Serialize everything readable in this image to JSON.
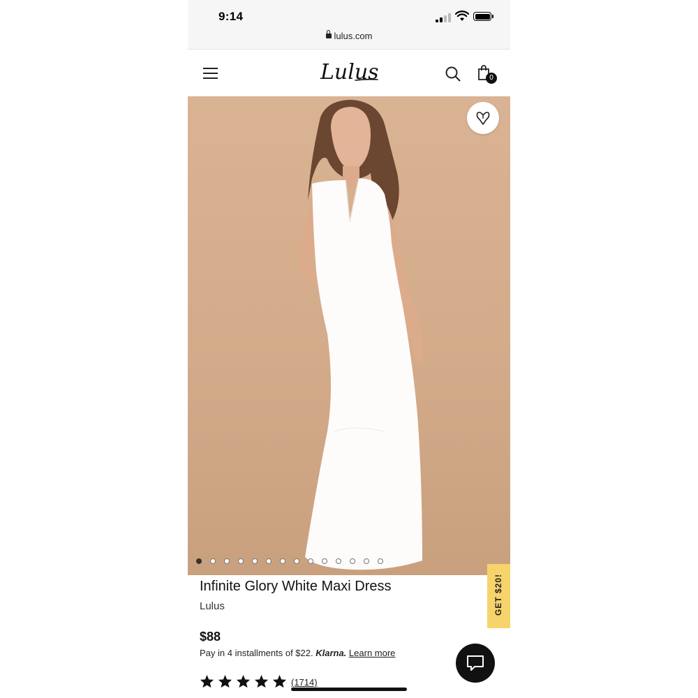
{
  "status_bar": {
    "time": "9:14",
    "url": "lulus.com",
    "icons": [
      "signal-icon",
      "wifi-icon",
      "battery-icon"
    ]
  },
  "header": {
    "logo_text": "Lulus",
    "cart_count": "0",
    "icons": [
      "menu-icon",
      "search-icon",
      "shopping-bag-icon"
    ]
  },
  "gallery": {
    "image_count": 14,
    "active_index": 0,
    "favorite_icon": "heart-v-icon",
    "background_color": "#d5ad8c"
  },
  "product": {
    "name": "Infinite Glory White Maxi Dress",
    "brand": "Lulus",
    "price": "$88",
    "installments_text": "Pay in 4 installments of $22.",
    "klarna": "Klarna.",
    "learn_more": "Learn more",
    "rating": 5,
    "review_count": "(1714)"
  },
  "promo": {
    "label": "GET $20!",
    "color": "#f6d36b"
  },
  "chat": {
    "icon": "chat-bubble-icon"
  }
}
